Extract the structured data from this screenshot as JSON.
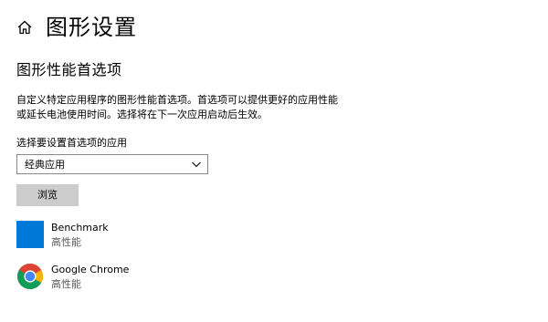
{
  "header": {
    "title": "图形设置",
    "home_icon": "home-icon"
  },
  "section": {
    "title": "图形性能首选项",
    "description_line1": "自定义特定应用程序的图形性能首选项。首选项可以提供更好的应用性能",
    "description_line2": "或延长电池使用时间。选择将在下一次应用启动后生效。"
  },
  "selector": {
    "label": "选择要设置首选项的应用",
    "value": "经典应用",
    "icon": "chevron-down-icon"
  },
  "browse_button": {
    "label": "浏览"
  },
  "apps": [
    {
      "name": "Benchmark",
      "preference": "高性能",
      "icon": "app-tile-icon"
    },
    {
      "name": "Google Chrome",
      "preference": "高性能",
      "icon": "chrome-icon"
    }
  ],
  "colors": {
    "accent": "#0078d7",
    "button_bg": "#cccccc",
    "secondary_text": "#5a5a5a"
  }
}
